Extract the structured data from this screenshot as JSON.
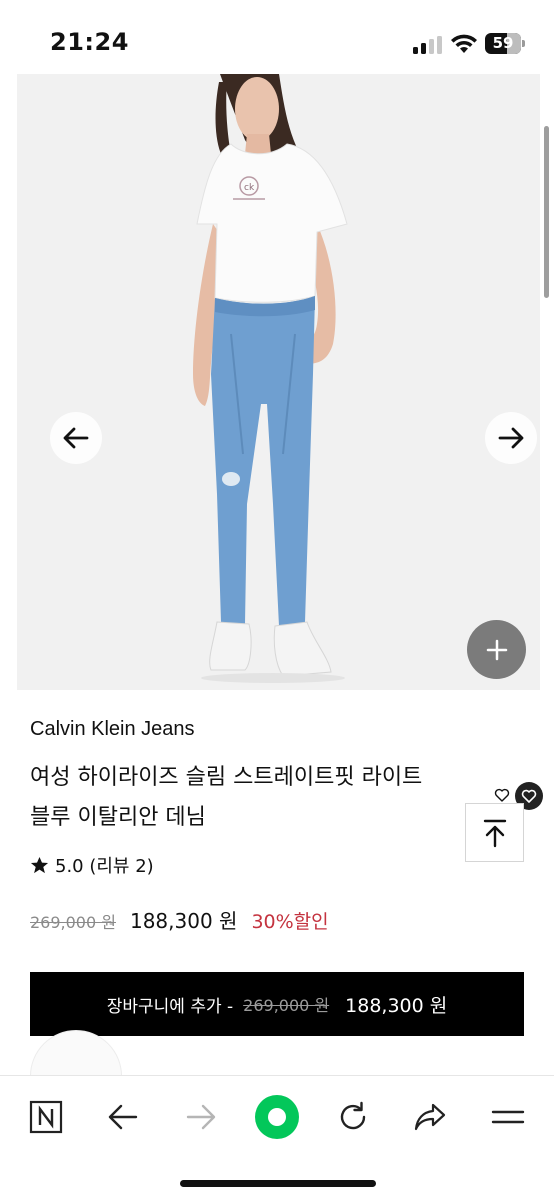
{
  "status_bar": {
    "time": "21:24",
    "battery": "59"
  },
  "product": {
    "brand": "Calvin Klein Jeans",
    "title_line1": "여성 하이라이즈 슬림 스트레이트핏 라이트",
    "title_line2": "블루 이탈리안 데님",
    "rating": "5.0 (리뷰 2)",
    "original_price": "269,000 원",
    "sale_price": "188,300 원",
    "discount": "30%할인"
  },
  "cart_button": {
    "label": "장바구니에 추가 -",
    "original_price": "269,000 원",
    "sale_price": "188,300 원"
  },
  "icons": {
    "prev": "arrow-left-icon",
    "next": "arrow-right-icon",
    "add": "plus-icon",
    "scroll_top": "arrow-up-to-top-icon",
    "wishlist": "heart-icon",
    "star": "star-icon"
  },
  "colors": {
    "discount": "#c4333f",
    "cart_button_bg": "#000000",
    "browser_home": "#03c75a"
  }
}
